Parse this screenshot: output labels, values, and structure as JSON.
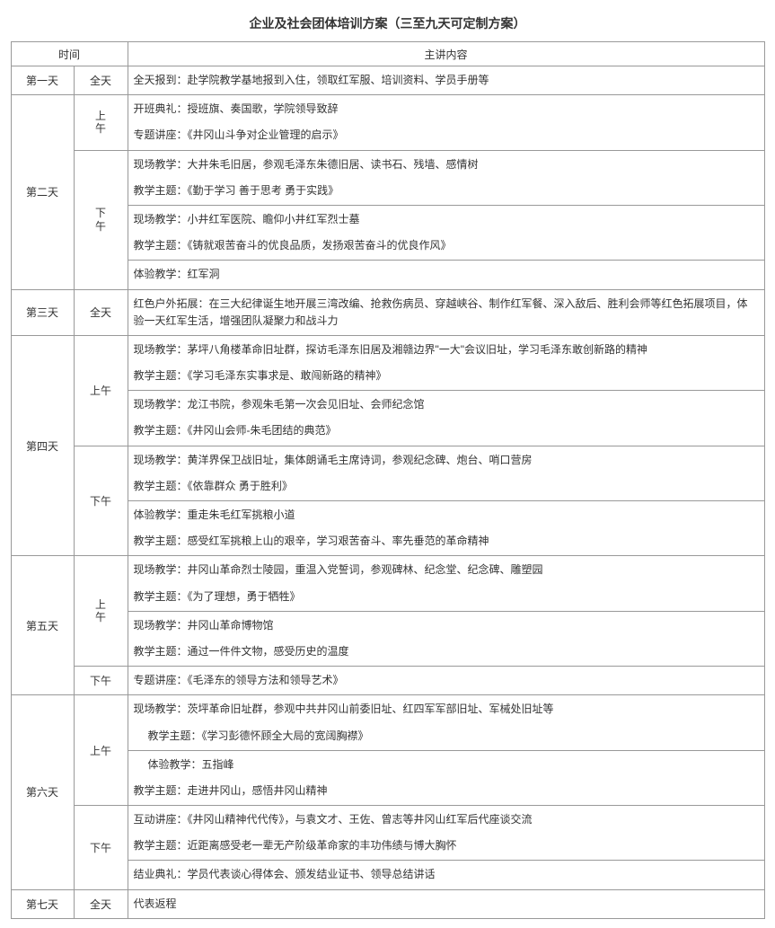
{
  "title": "企业及社会团体培训方案（三至九天可定制方案）",
  "headers": {
    "time": "时间",
    "content": "主讲内容"
  },
  "periods": {
    "full": "全天",
    "am_a": "上",
    "am_b": "午",
    "pm_a": "下",
    "pm_b": "午",
    "am": "上午",
    "pm": "下午"
  },
  "days": {
    "d1": {
      "label": "第一天",
      "full": "全天报到：赴学院教学基地报到入住，领取红军服、培训资料、学员手册等"
    },
    "d2": {
      "label": "第二天",
      "am": {
        "l1": "开班典礼：授班旗、奏国歌，学院领导致辞",
        "l2": "专题讲座：《井冈山斗争对企业管理的启示》"
      },
      "pm": {
        "b1l1": "现场教学：大井朱毛旧居，参观毛泽东朱德旧居、读书石、残墙、感情树",
        "b1l2": "教学主题：《勤于学习  善于思考  勇于实践》",
        "b2l1": "现场教学：小井红军医院、瞻仰小井红军烈士墓",
        "b2l2": "教学主题：《铸就艰苦奋斗的优良品质，发扬艰苦奋斗的优良作风》",
        "b3l1": "体验教学：红军洞"
      }
    },
    "d3": {
      "label": "第三天",
      "full": "红色户外拓展：在三大纪律诞生地开展三湾改编、抢救伤病员、穿越峡谷、制作红军餐、深入敌后、胜利会师等红色拓展项目，体验一天红军生活，增强团队凝聚力和战斗力"
    },
    "d4": {
      "label": "第四天",
      "am": {
        "b1l1": "现场教学：茅坪八角楼革命旧址群，探访毛泽东旧居及湘赣边界\"一大\"会议旧址，学习毛泽东敢创新路的精神",
        "b1l2": "教学主题：《学习毛泽东实事求是、敢闯新路的精神》",
        "b2l1": "现场教学：龙江书院，参观朱毛第一次会见旧址、会师纪念馆",
        "b2l2": "教学主题：《井冈山会师-朱毛团结的典范》"
      },
      "pm": {
        "b1l1": "现场教学：黄洋界保卫战旧址，集体朗诵毛主席诗词，参观纪念碑、炮台、哨口营房",
        "b1l2": "教学主题：《依靠群众  勇于胜利》",
        "b2l1": "体验教学：重走朱毛红军挑粮小道",
        "b2l2": "教学主题：感受红军挑粮上山的艰辛，学习艰苦奋斗、率先垂范的革命精神"
      }
    },
    "d5": {
      "label": "第五天",
      "am": {
        "b1l1": "现场教学：井冈山革命烈士陵园，重温入党誓词，参观碑林、纪念堂、纪念碑、雕塑园",
        "b1l2": "教学主题：《为了理想，勇于牺牲》",
        "b2l1": "现场教学：井冈山革命博物馆",
        "b2l2": "教学主题：通过一件件文物，感受历史的温度"
      },
      "pm": "专题讲座：《毛泽东的领导方法和领导艺术》"
    },
    "d6": {
      "label": "第六天",
      "am": {
        "b1l1": "现场教学：茨坪革命旧址群，参观中共井冈山前委旧址、红四军军部旧址、军械处旧址等",
        "b1l2": "教学主题：《学习彭德怀顾全大局的宽阔胸襟》",
        "b2l1": "体验教学：五指峰",
        "b2l2": "教学主题：走进井冈山，感悟井冈山精神"
      },
      "pm": {
        "l1": "互动讲座：《井冈山精神代代传》，与袁文才、王佐、曾志等井冈山红军后代座谈交流",
        "l2": "教学主题：近距离感受老一辈无产阶级革命家的丰功伟绩与博大胸怀",
        "l3": "结业典礼：学员代表谈心得体会、颁发结业证书、领导总结讲话"
      }
    },
    "d7": {
      "label": "第七天",
      "full": "代表返程"
    }
  }
}
